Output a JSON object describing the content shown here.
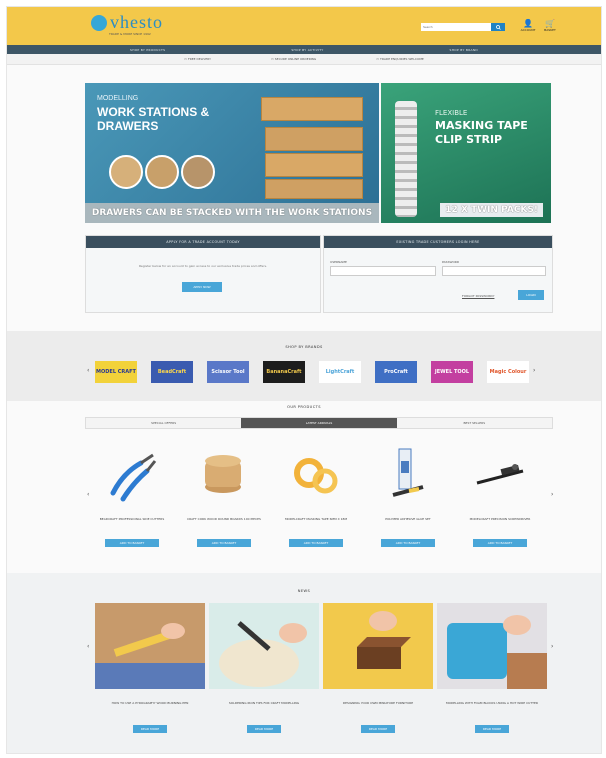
{
  "header": {
    "logo_text": "vhesto",
    "logo_tagline": "TRADE & MORE SINCE 1992",
    "search_placeholder": "Search",
    "account_label": "ACCOUNT",
    "basket_label": "BASKET"
  },
  "nav_primary": [
    "SHOP BY PRODUCTS",
    "SHOP BY ACTIVITY",
    "SHOP BY BRAND"
  ],
  "nav_secondary": [
    "FREE DELIVERY",
    "SECURE ONLINE ORDERING",
    "TRADE ENQUIRIES WELCOME"
  ],
  "banner_left": {
    "kicker": "MODELLING",
    "headline": "WORK STATIONS & DRAWERS",
    "footer": "DRAWERS CAN BE STACKED WITH THE WORK STATIONS"
  },
  "banner_right": {
    "kicker": "FLEXIBLE",
    "headline": "MASKING TAPE CLIP STRIP",
    "footer": "12 X TWIN PACKS!"
  },
  "trade_apply": {
    "header": "APPLY FOR A TRADE ACCOUNT TODAY",
    "text": "Register below for an account to gain access to our exclusive trade prices and offers.",
    "button": "APPLY NOW"
  },
  "trade_login": {
    "header": "EXISTING TRADE CUSTOMERS LOGIN HERE",
    "username_label": "USERNAME",
    "password_label": "PASSWORD",
    "forgot_link": "FORGOT PASSWORD?",
    "button": "LOGIN"
  },
  "brands": {
    "title": "SHOP BY BRANDS",
    "items": [
      {
        "name": "MODEL CRAFT",
        "bg": "#f2d23a",
        "fg": "#2b3a8f"
      },
      {
        "name": "BeadCraft",
        "bg": "#3a5bb0",
        "fg": "#ffd84a"
      },
      {
        "name": "Scissor Tool",
        "bg": "#5a78c8",
        "fg": "#ffffff"
      },
      {
        "name": "BananaCraft",
        "bg": "#1d1d1d",
        "fg": "#f2c94c"
      },
      {
        "name": "LightCraft",
        "bg": "#ffffff",
        "fg": "#4aa3d8"
      },
      {
        "name": "ProCraft",
        "bg": "#3f6fc4",
        "fg": "#ffffff"
      },
      {
        "name": "JEWEL TOOL",
        "bg": "#c33fa0",
        "fg": "#ffffff"
      },
      {
        "name": "Magic Colour",
        "bg": "#ffffff",
        "fg": "#e0562b"
      }
    ]
  },
  "products": {
    "title": "OUR PRODUCTS",
    "tabs": [
      "SPECIAL OFFERS",
      "LATEST ARRIVALS",
      "BEST SELLERS"
    ],
    "active_tab": 1,
    "items": [
      {
        "name": "BEADCRAFT PROFESSIONAL SIDE CUTTERS",
        "button": "ADD TO BASKET"
      },
      {
        "name": "CRAFT CORK WOOD ROUND BOARDS 100 PIECES",
        "button": "ADD TO BASKET"
      },
      {
        "name": "MODELCRAFT MASKING TAPE 6MM X 18M",
        "button": "ADD TO BASKET"
      },
      {
        "name": "POLYMER ADHESIVE GLUE SET",
        "button": "ADD TO BASKET"
      },
      {
        "name": "MODELCRAFT PRECISION SCREWDRIVER",
        "button": "ADD TO BASKET"
      }
    ]
  },
  "news": {
    "title": "NEWS",
    "items": [
      {
        "name": "HOW TO USE A PYROGRAPHY WOOD BURNING PEN",
        "button": "READ MORE"
      },
      {
        "name": "SOLDERING IRON TIPS FOR CRAFT MODELLING",
        "button": "READ MORE"
      },
      {
        "name": "DESIGNING YOUR OWN MINIATURE FURNITURE",
        "button": "READ MORE"
      },
      {
        "name": "MODELLING WITH FOAM BLOCKS USING A HOT WIRE CUTTER",
        "button": "READ MORE"
      }
    ]
  }
}
